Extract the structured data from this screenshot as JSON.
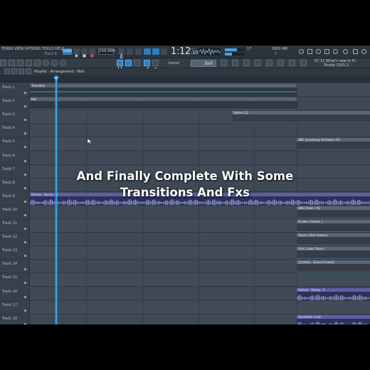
{
  "toolbar": {
    "menu": "TERNS  VIEW  OPTIONS  TOOLS  HELP",
    "track_label": "Track 8",
    "mode_label": "SONG",
    "bpm": "155.000",
    "time_main": "1:12",
    "time_frac": ":10",
    "time_unit": "B:S:T",
    "memory": "2850 MB",
    "cpu_value": "17",
    "cpu_small": "0",
    "news_line1": "07.11  What's new in FL",
    "news_line2": "Studio 2025.2"
  },
  "toolbar2": {
    "snap_label": "(none)",
    "pattern_name": "Bell"
  },
  "playlist": {
    "breadcrumb": "Playlist - Arrangement › Bell"
  },
  "tracks": [
    {
      "name": "Track 1"
    },
    {
      "name": "Track 2"
    },
    {
      "name": "Track 3"
    },
    {
      "name": "Track 4"
    },
    {
      "name": "Track 5"
    },
    {
      "name": "Track 6"
    },
    {
      "name": "Track 7"
    },
    {
      "name": "Track 8"
    },
    {
      "name": "Track 9"
    },
    {
      "name": "Track 10"
    },
    {
      "name": "Track 11"
    },
    {
      "name": "Track 12"
    },
    {
      "name": "Track 13"
    },
    {
      "name": "Track 14"
    },
    {
      "name": "Track 15"
    },
    {
      "name": "Track 16"
    },
    {
      "name": "Track 17"
    },
    {
      "name": "Track 18"
    }
  ],
  "clips": [
    {
      "track": 1,
      "label": "Transition",
      "kind": "auto",
      "start": 0.0,
      "end": 0.785
    },
    {
      "track": 2,
      "label": "Bell",
      "kind": "auto",
      "start": 0.0,
      "end": 0.785
    },
    {
      "track": 3,
      "label": "Pattern 12",
      "kind": "gray",
      "start": 0.595,
      "end": 1.0
    },
    {
      "track": 5,
      "label": "BBC Symphony Orchestra #3",
      "kind": "gray",
      "start": 0.785,
      "end": 1.0
    },
    {
      "track": 9,
      "label": "Detroit - Stomp - 4",
      "kind": "audio",
      "start": 0.0,
      "end": 1.0
    },
    {
      "track": 10,
      "label": "808 | Kaoli | #2",
      "kind": "gray",
      "start": 0.785,
      "end": 1.0
    },
    {
      "track": 11,
      "label": "Hi Hat | Garden |",
      "kind": "gray",
      "start": 0.785,
      "end": 1.0
    },
    {
      "track": 12,
      "label": "Snare | Alex Adame |",
      "kind": "gray",
      "start": 0.785,
      "end": 1.0
    },
    {
      "track": 13,
      "label": "Kick | Lawn Team |",
      "kind": "gray",
      "start": 0.785,
      "end": 1.0
    },
    {
      "track": 14,
      "label": "Cymbals - Snare [Freeze]",
      "kind": "gray",
      "start": 0.785,
      "end": 1.0
    },
    {
      "track": 16,
      "label": "Detroit - Stomp - 2",
      "kind": "audio",
      "start": 0.785,
      "end": 1.0
    },
    {
      "track": 18,
      "label": "Rocketfist Crash",
      "kind": "audio",
      "start": 0.785,
      "end": 1.0
    }
  ],
  "playhead_position": 0.075,
  "caption": {
    "line1": "And Finally Complete With Some",
    "line2": "Transitions And Fxs"
  },
  "colors": {
    "accent": "#3aa0e6",
    "audio_clip": "#5a5fa6",
    "background": "#3b4653"
  },
  "icons": [
    "play-icon",
    "stop-icon",
    "record-icon",
    "metronome-icon",
    "magnet-icon",
    "pencil-icon",
    "brush-icon",
    "mute-icon",
    "zoom-icon",
    "mouse-cursor-icon"
  ]
}
